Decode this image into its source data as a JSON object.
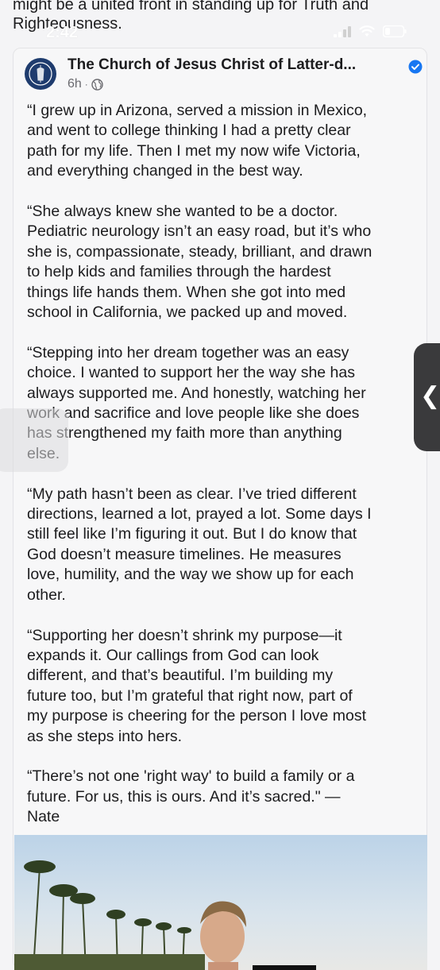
{
  "prev_text": "might be a united front in standing up for Truth and Righteousness.",
  "status_bar": {
    "time": "2:42"
  },
  "post": {
    "page_name": "The Church of Jesus Christ of Latter-d...",
    "time_ago": "6h",
    "separator": "·",
    "paragraphs": [
      "“I grew up in Arizona, served a mission in Mexico,\nand went to college thinking I had a pretty clear\npath for my life. Then I met my now wife Victoria,\nand everything changed in the best way.",
      "“She always knew she wanted to be a doctor.\nPediatric neurology isn’t an easy road, but it’s who\nshe is, compassionate, steady, brilliant, and drawn\nto help kids and families through the hardest\nthings life hands them. When she got into med\nschool in California, we packed up and moved.",
      "“Stepping into her dream together was an easy\nchoice. I wanted to support her the way she has\nalways supported me. And honestly, watching her\nwork and sacrifice and love people like she does\nhas strengthened my faith more than anything\nelse.",
      "“My path hasn’t been as clear. I’ve tried different\ndirections, learned a lot, prayed a lot. Some days I\nstill feel like I’m figuring it out. But I do know that\nGod doesn’t measure timelines. He measures\nlove, humility, and the way we show up for each\nother.",
      "“Supporting her doesn’t shrink my purpose—it\nexpands it. Our callings from God can look\ndifferent, and that’s beautiful. I’m building my\nfuture too, but I’m grateful that right now, part of\nmy purpose is cheering for the person I love most\nas she steps into hers.",
      "“There’s not one 'right way' to build a family or a\nfuture. For us, this is ours. And it’s sacred.\" —\nNate"
    ]
  },
  "colors": {
    "verified": "#1877f2",
    "avatar_bg": "#1f3c6e",
    "side_handle": "#3a3a3c"
  }
}
